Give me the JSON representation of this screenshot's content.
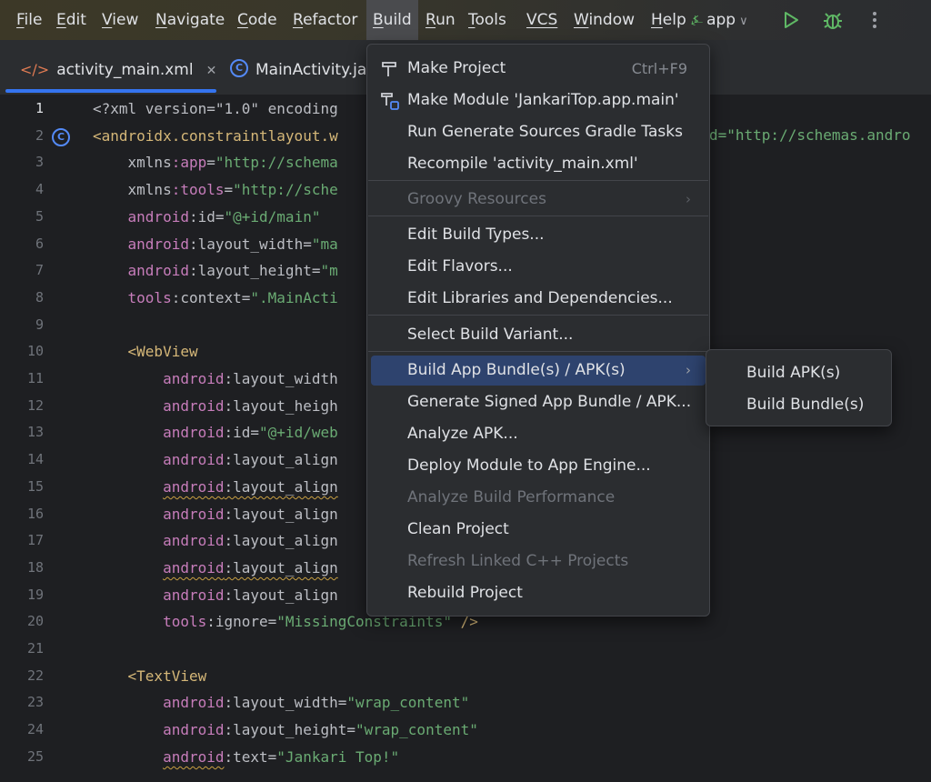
{
  "menubar": {
    "items": [
      {
        "label": "File",
        "mnemonic": "F",
        "rest": "ile"
      },
      {
        "label": "Edit",
        "mnemonic": "E",
        "rest": "dit"
      },
      {
        "label": "View",
        "mnemonic": "V",
        "rest": "iew"
      },
      {
        "label": "Navigate",
        "mnemonic": "N",
        "rest": "avigate"
      },
      {
        "label": "Code",
        "mnemonic": "C",
        "rest": "ode"
      },
      {
        "label": "Refactor",
        "mnemonic": "R",
        "rest": "efactor"
      },
      {
        "label": "Build",
        "mnemonic": "B",
        "rest": "uild"
      },
      {
        "label": "Run",
        "mnemonic": "R",
        "rest": "un"
      },
      {
        "label": "Tools",
        "mnemonic": "T",
        "rest": "ools"
      },
      {
        "label": "VCS",
        "mnemonic": "",
        "rest": "VCS"
      },
      {
        "label": "Window",
        "mnemonic": "W",
        "rest": "indow"
      },
      {
        "label": "Help",
        "mnemonic": "H",
        "rest": "elp"
      }
    ],
    "run_config": "app"
  },
  "tabs": [
    {
      "label": "activity_main.xml",
      "icon": "</>"
    },
    {
      "label": "MainActivity.ja",
      "icon": "C"
    }
  ],
  "build_menu": {
    "items": [
      {
        "label": "Make Project",
        "shortcut": "Ctrl+F9",
        "icon": "hammer-icon"
      },
      {
        "label": "Make Module 'JankariTop.app.main'",
        "icon": "make-module-icon"
      },
      {
        "label": "Run Generate Sources Gradle Tasks"
      },
      {
        "label": "Recompile 'activity_main.xml'"
      },
      {
        "label": "Groovy Resources",
        "disabled": true
      },
      {
        "label": "Edit Build Types..."
      },
      {
        "label": "Edit Flavors..."
      },
      {
        "label": "Edit Libraries and Dependencies..."
      },
      {
        "label": "Select Build Variant..."
      },
      {
        "label": "Build App Bundle(s) / APK(s)",
        "highlighted": true
      },
      {
        "label": "Generate Signed App Bundle / APK..."
      },
      {
        "label": "Analyze APK..."
      },
      {
        "label": "Deploy Module to App Engine..."
      },
      {
        "label": "Analyze Build Performance",
        "disabled": true
      },
      {
        "label": "Clean Project"
      },
      {
        "label": "Refresh Linked C++ Projects",
        "disabled": true
      },
      {
        "label": "Rebuild Project"
      }
    ]
  },
  "submenu": {
    "items": [
      {
        "label": "Build APK(s)"
      },
      {
        "label": "Build Bundle(s)"
      }
    ]
  },
  "editor": {
    "line_numbers": [
      "1",
      "2",
      "3",
      "4",
      "5",
      "6",
      "7",
      "8",
      "9",
      "10",
      "11",
      "12",
      "13",
      "14",
      "15",
      "16",
      "17",
      "18",
      "19",
      "20",
      "21",
      "22",
      "23",
      "24",
      "25"
    ],
    "lines": [
      [
        {
          "t": "<?xml version=\"1.0\" encoding",
          "c": "attr"
        }
      ],
      [
        {
          "t": "<androidx.constraintlayout.w",
          "c": "tag"
        }
      ],
      [
        {
          "t": "    xmlns",
          "c": "attr"
        },
        {
          "t": ":app",
          "c": "ns"
        },
        {
          "t": "=",
          "c": "attr"
        },
        {
          "t": "\"http://schema",
          "c": "str"
        }
      ],
      [
        {
          "t": "    xmlns",
          "c": "attr"
        },
        {
          "t": ":tools",
          "c": "ns"
        },
        {
          "t": "=",
          "c": "attr"
        },
        {
          "t": "\"http://sche",
          "c": "str"
        }
      ],
      [
        {
          "t": "    android",
          "c": "ns"
        },
        {
          "t": ":id=",
          "c": "attr"
        },
        {
          "t": "\"@+id/main\"",
          "c": "str"
        }
      ],
      [
        {
          "t": "    android",
          "c": "ns"
        },
        {
          "t": ":layout_width=",
          "c": "attr"
        },
        {
          "t": "\"ma",
          "c": "str"
        }
      ],
      [
        {
          "t": "    android",
          "c": "ns"
        },
        {
          "t": ":layout_height=",
          "c": "attr"
        },
        {
          "t": "\"m",
          "c": "str"
        }
      ],
      [
        {
          "t": "    tools",
          "c": "ns"
        },
        {
          "t": ":context=",
          "c": "attr"
        },
        {
          "t": "\".MainActi",
          "c": "str"
        }
      ],
      [
        {
          "t": "",
          "c": "attr"
        }
      ],
      [
        {
          "t": "    <WebView",
          "c": "tag"
        }
      ],
      [
        {
          "t": "        android",
          "c": "ns"
        },
        {
          "t": ":layout_width",
          "c": "attr"
        }
      ],
      [
        {
          "t": "        android",
          "c": "ns"
        },
        {
          "t": ":layout_heigh",
          "c": "attr"
        }
      ],
      [
        {
          "t": "        android",
          "c": "ns"
        },
        {
          "t": ":id=",
          "c": "attr"
        },
        {
          "t": "\"@+id/web",
          "c": "str"
        }
      ],
      [
        {
          "t": "        android",
          "c": "ns"
        },
        {
          "t": ":layout_align",
          "c": "attr"
        }
      ],
      [
        {
          "t": "        ",
          "c": "attr"
        },
        {
          "t": "android",
          "c": "ns",
          "w": true
        },
        {
          "t": ":layout_align",
          "c": "attr",
          "w": true
        }
      ],
      [
        {
          "t": "        android",
          "c": "ns"
        },
        {
          "t": ":layout_align",
          "c": "attr"
        }
      ],
      [
        {
          "t": "        android",
          "c": "ns"
        },
        {
          "t": ":layout_align",
          "c": "attr"
        }
      ],
      [
        {
          "t": "        ",
          "c": "attr"
        },
        {
          "t": "android",
          "c": "ns",
          "w": true
        },
        {
          "t": ":layout_align",
          "c": "attr",
          "w": true
        }
      ],
      [
        {
          "t": "        android",
          "c": "ns"
        },
        {
          "t": ":layout_align",
          "c": "attr"
        }
      ],
      [
        {
          "t": "        tools",
          "c": "ns"
        },
        {
          "t": ":ignore=",
          "c": "attr"
        },
        {
          "t": "\"MissingConstraints\"",
          "c": "str"
        },
        {
          "t": " />",
          "c": "tag"
        }
      ],
      [
        {
          "t": "",
          "c": "attr"
        }
      ],
      [
        {
          "t": "    <TextView",
          "c": "tag"
        }
      ],
      [
        {
          "t": "        android",
          "c": "ns"
        },
        {
          "t": ":layout_width=",
          "c": "attr"
        },
        {
          "t": "\"wrap_content\"",
          "c": "str"
        }
      ],
      [
        {
          "t": "        android",
          "c": "ns"
        },
        {
          "t": ":layout_height=",
          "c": "attr"
        },
        {
          "t": "\"wrap_content\"",
          "c": "str"
        }
      ],
      [
        {
          "t": "        ",
          "c": "attr"
        },
        {
          "t": "android",
          "c": "ns",
          "w": true
        },
        {
          "t": ":text=",
          "c": "attr"
        },
        {
          "t": "\"Jankari Top!\"",
          "c": "str"
        }
      ]
    ],
    "line2_tail": "d=\"http://schemas.andro"
  },
  "colors": {
    "accent": "#3574f0",
    "menu_highlight": "#2e436e",
    "string": "#6aab73",
    "tag": "#d5b778",
    "namespace": "#c77dbb"
  }
}
